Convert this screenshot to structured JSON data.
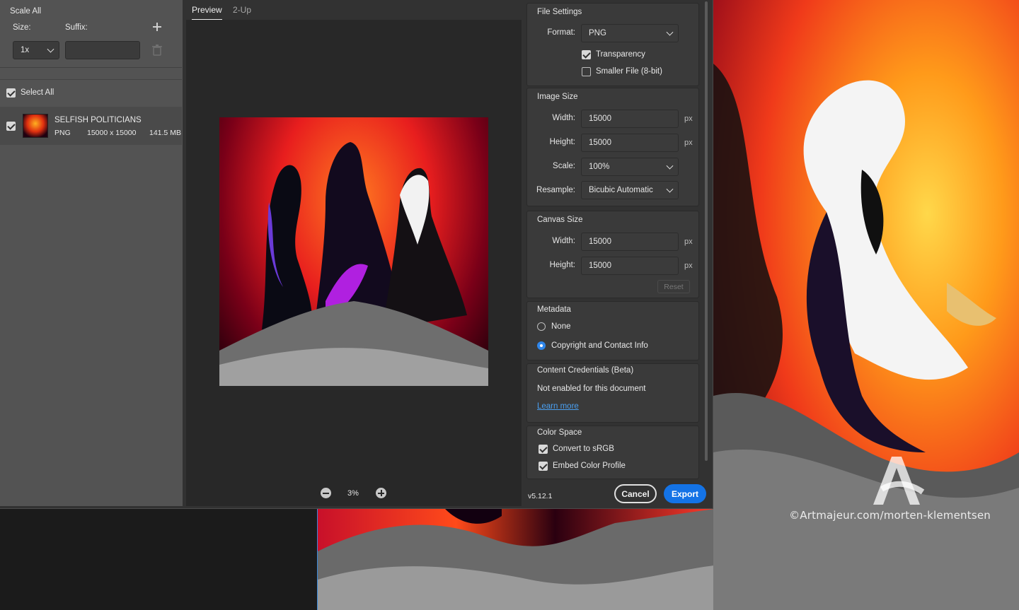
{
  "left_panel": {
    "scale_all_label": "Scale All",
    "size_label": "Size:",
    "suffix_label": "Suffix:",
    "size_value": "1x",
    "suffix_value": "",
    "select_all_label": "Select All",
    "asset": {
      "name": "SELFISH POLITICIANS",
      "format": "PNG",
      "dimensions": "15000 x 15000",
      "size": "141.5 MB",
      "checked": true
    }
  },
  "preview": {
    "tabs": [
      "Preview",
      "2-Up"
    ],
    "active_tab": "Preview",
    "zoom": "3%"
  },
  "file_settings": {
    "title": "File Settings",
    "format_label": "Format:",
    "format_value": "PNG",
    "transparency_label": "Transparency",
    "transparency_checked": true,
    "smaller_file_label": "Smaller File (8-bit)",
    "smaller_file_checked": false
  },
  "image_size": {
    "title": "Image Size",
    "width_label": "Width:",
    "width_value": "15000",
    "height_label": "Height:",
    "height_value": "15000",
    "unit": "px",
    "scale_label": "Scale:",
    "scale_value": "100%",
    "resample_label": "Resample:",
    "resample_value": "Bicubic Automatic"
  },
  "canvas_size": {
    "title": "Canvas Size",
    "width_label": "Width:",
    "width_value": "15000",
    "height_label": "Height:",
    "height_value": "15000",
    "unit": "px",
    "reset_label": "Reset"
  },
  "metadata": {
    "title": "Metadata",
    "options": [
      "None",
      "Copyright and Contact Info"
    ],
    "selected": "Copyright and Contact Info"
  },
  "content_credentials": {
    "title": "Content Credentials (Beta)",
    "status": "Not enabled for this document",
    "link": "Learn more"
  },
  "color_space": {
    "title": "Color Space",
    "convert_label": "Convert to sRGB",
    "convert_checked": true,
    "embed_label": "Embed Color Profile",
    "embed_checked": true
  },
  "footer": {
    "version": "v5.12.1",
    "cancel_label": "Cancel",
    "export_label": "Export"
  },
  "watermark": {
    "text": "©Artmajeur.com/morten-klementsen"
  },
  "colors": {
    "accent": "#1473e6",
    "radio_selected": "#2f86ea",
    "link": "#4a9ff0"
  }
}
